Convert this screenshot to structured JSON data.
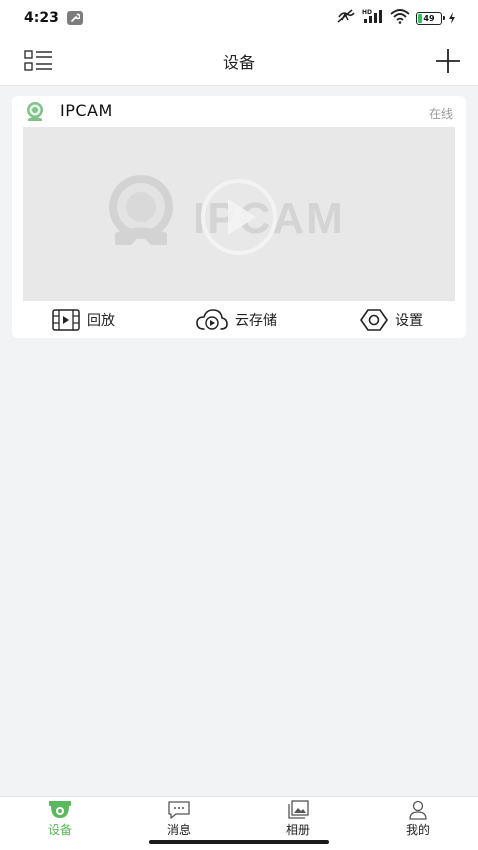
{
  "status_bar": {
    "time": "4:23",
    "battery_level": "49",
    "icons": [
      "wrench-icon",
      "mute-icon",
      "signal-icon",
      "wifi-icon",
      "battery-icon",
      "charging-icon"
    ]
  },
  "header": {
    "title": "设备",
    "menu_icon": "list-grid-icon",
    "add_icon": "plus-icon"
  },
  "device_card": {
    "name": "IPCAM",
    "status": "在线",
    "preview_logo_text": "IPCAM",
    "actions": {
      "playback": "回放",
      "cloud_storage": "云存储",
      "settings": "设置"
    }
  },
  "tabbar": {
    "tabs": [
      {
        "label": "设备",
        "icon": "camera-icon",
        "active": true
      },
      {
        "label": "消息",
        "icon": "message-icon",
        "active": false
      },
      {
        "label": "相册",
        "icon": "album-icon",
        "active": false
      },
      {
        "label": "我的",
        "icon": "user-icon",
        "active": false
      }
    ]
  },
  "colors": {
    "accent": "#5cb85c",
    "background": "#f2f3f5",
    "card": "#ffffff",
    "muted_text": "#9a9a9a",
    "battery_fill": "#33c15e"
  }
}
